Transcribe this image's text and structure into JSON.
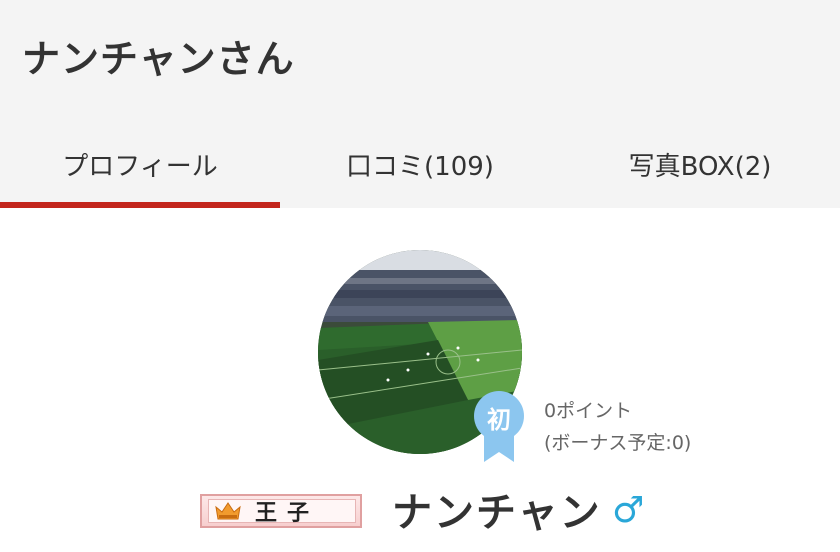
{
  "page_title": "ナンチャンさん",
  "tabs": [
    {
      "label": "プロフィール",
      "active": true
    },
    {
      "label": "口コミ(109)",
      "active": false
    },
    {
      "label": "写真BOX(2)",
      "active": false
    }
  ],
  "profile": {
    "badge": "初",
    "points": "0ポイント",
    "bonus": "(ボーナス予定:0)",
    "rank": "王子",
    "name": "ナンチャン",
    "gender_symbol": "♂"
  },
  "colors": {
    "accent": "#c3261c",
    "badge": "#8cc6ef",
    "gender": "#2aa7d8"
  },
  "icons": [
    "crown-icon",
    "male-icon",
    "beginner-badge-icon"
  ]
}
